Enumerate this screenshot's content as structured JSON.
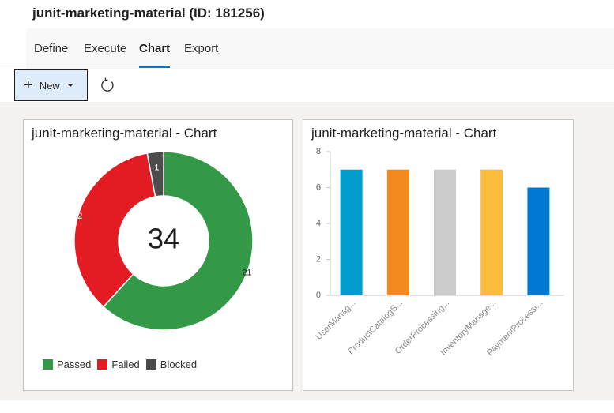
{
  "header": {
    "title": "junit-marketing-material (ID: 181256)"
  },
  "tabs": [
    {
      "label": "Define"
    },
    {
      "label": "Execute"
    },
    {
      "label": "Chart"
    },
    {
      "label": "Export"
    }
  ],
  "toolbar": {
    "new_label": "New"
  },
  "colors": {
    "passed": "#339947",
    "failed": "#e31b23",
    "blocked": "#4c4c4c",
    "bar_colors": [
      "#009ccc",
      "#f28a1e",
      "#cccccc",
      "#fbbc3d",
      "#0078d4"
    ],
    "accent": "#0078d4"
  },
  "donut_card": {
    "title": "junit-marketing-material - Chart",
    "total": "34",
    "legend": [
      "Passed",
      "Failed",
      "Blocked"
    ]
  },
  "bar_card": {
    "title": "junit-marketing-material - Chart"
  },
  "chart_data": [
    {
      "type": "pie",
      "title": "junit-marketing-material - Chart",
      "center_label": "34",
      "categories": [
        "Passed",
        "Failed",
        "Blocked"
      ],
      "values": [
        21,
        12,
        1
      ],
      "legend": "bottom-left"
    },
    {
      "type": "bar",
      "title": "junit-marketing-material - Chart",
      "categories": [
        "UserManag...",
        "ProductCatalogS...",
        "OrderProcessing...",
        "InventoryManage...",
        "PaymentProcessi..."
      ],
      "values": [
        7,
        7,
        7,
        7,
        6
      ],
      "ylim": [
        0,
        8
      ],
      "yticks": [
        0,
        2,
        4,
        6,
        8
      ],
      "grid": false,
      "xlabel": "",
      "ylabel": ""
    }
  ]
}
